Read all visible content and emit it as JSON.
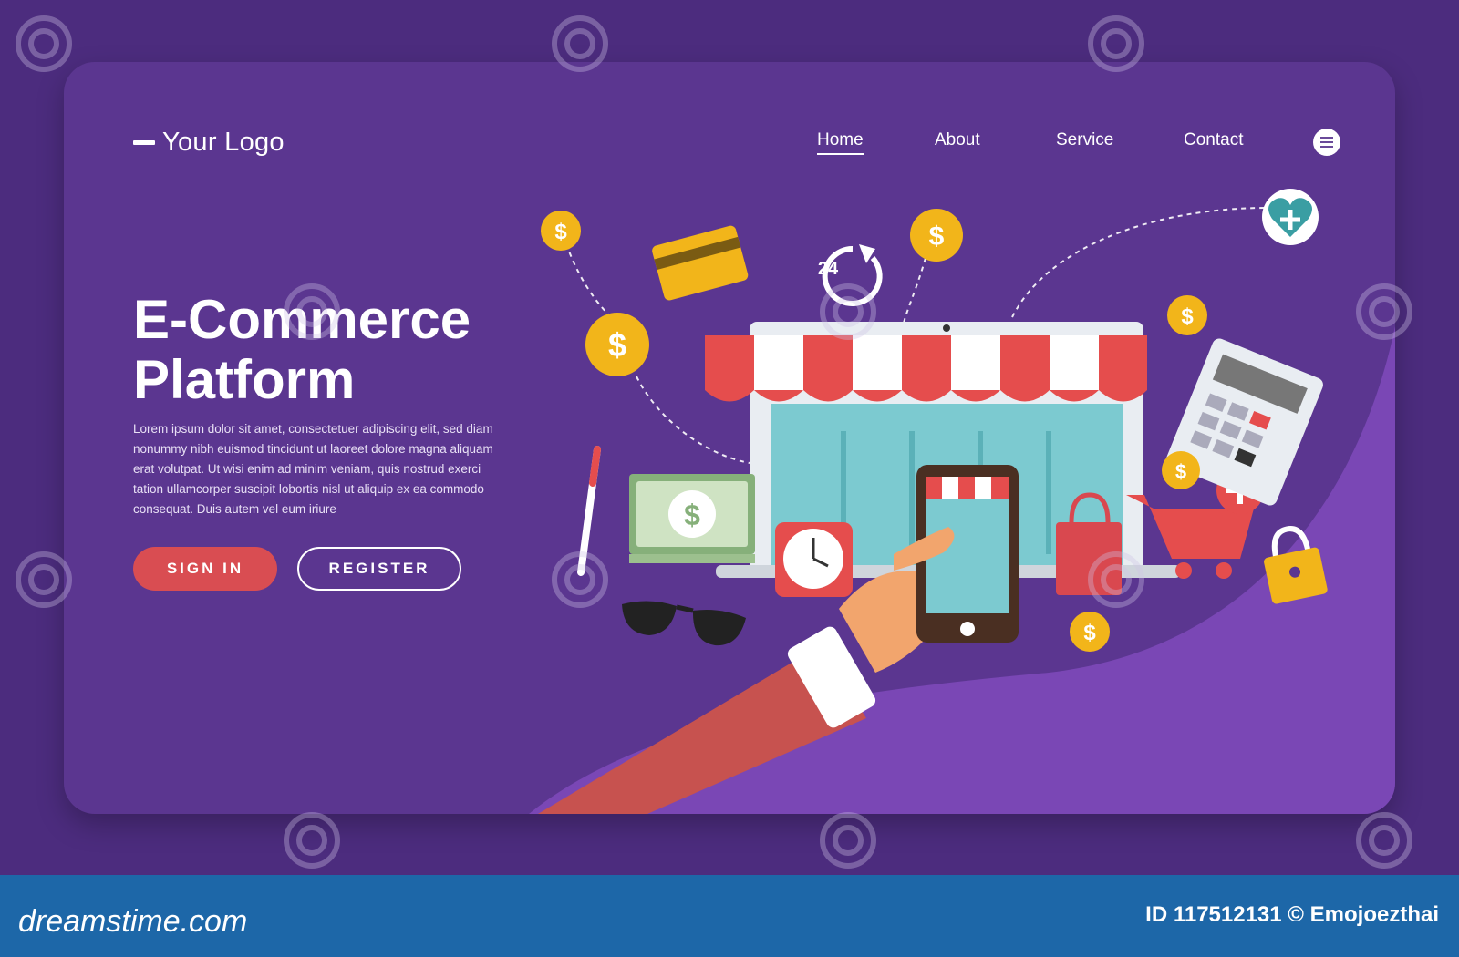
{
  "logo": {
    "text": "Your Logo"
  },
  "nav": {
    "items": [
      "Home",
      "About",
      "Service",
      "Contact"
    ],
    "active": "Home"
  },
  "hero": {
    "title_line1": "E-Commerce",
    "title_line2": "Platform",
    "body": "Lorem ipsum dolor sit amet, consectetuer adipiscing elit, sed diam nonummy nibh euismod tincidunt ut laoreet dolore magna aliquam erat volutpat. Ut wisi enim ad minim veniam, quis nostrud exerci tation ullamcorper suscipit lobortis nisl ut aliquip ex ea commodo consequat. Duis autem vel eum iriure",
    "signin_label": "SIGN IN",
    "register_label": "REGISTER"
  },
  "illustration": {
    "coin_symbol": "$",
    "clock_text": "24"
  },
  "footer": {
    "brand": "dreamstime.com",
    "id_text": "ID 117512131 © Emojoezthai"
  },
  "watermark_text": "dreamstime",
  "colors": {
    "background": "#4c2c7e",
    "card": "#5b3690",
    "accent_red": "#d94d52",
    "footer_blue": "#1d67a8",
    "coin_gold": "#f2b51a"
  }
}
